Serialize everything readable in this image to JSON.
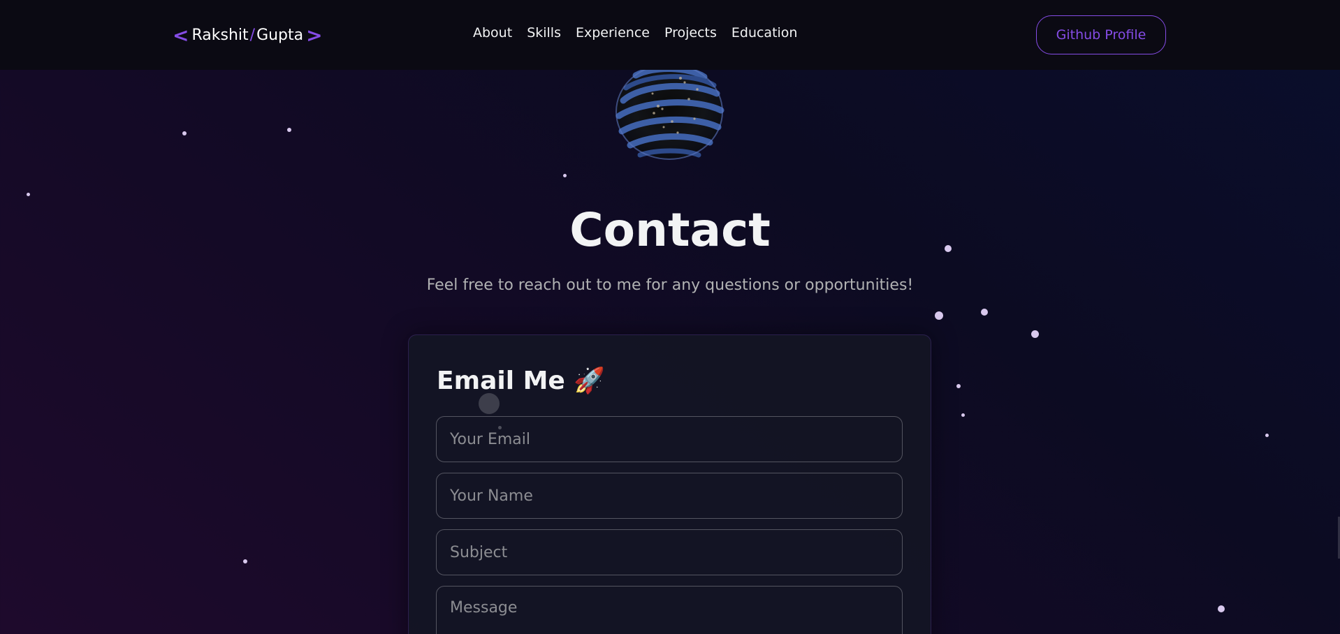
{
  "nav": {
    "logo": {
      "left_bracket": "<",
      "first_name": "Rakshit",
      "separator": "/",
      "last_name": "Gupta",
      "right_bracket": ">"
    },
    "links": [
      "About",
      "Skills",
      "Experience",
      "Projects",
      "Education"
    ],
    "github_button": "Github Profile"
  },
  "contact": {
    "title": "Contact",
    "subtitle": "Feel free to reach out to me for any questions or opportunities!"
  },
  "form": {
    "title": "Email Me 🚀",
    "email_placeholder": "Your Email",
    "name_placeholder": "Your Name",
    "subject_placeholder": "Subject",
    "message_placeholder": "Message"
  },
  "colors": {
    "accent": "#854ce6",
    "nav_background": "#0b0a13",
    "card_background": "#141624",
    "primary_text": "#f2f3f4",
    "secondary_text": "#b1b2b3"
  },
  "icons": {
    "globe": "wireframe-globe-icon"
  }
}
